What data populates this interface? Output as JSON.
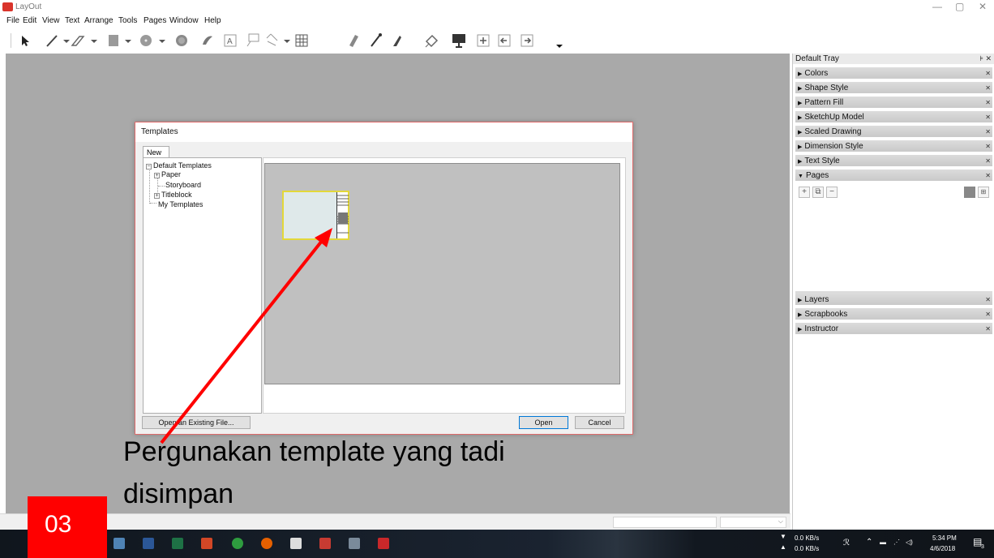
{
  "window": {
    "title": "LayOut",
    "controls": [
      "minimize",
      "maximize",
      "close"
    ]
  },
  "menu": [
    "File",
    "Edit",
    "View",
    "Text",
    "Arrange",
    "Tools",
    "Pages",
    "Window",
    "Help"
  ],
  "toolbar": {
    "icons": [
      "select-icon",
      "line-icon",
      "freehand-icon",
      "rectangle-icon",
      "circle-icon",
      "polygon-icon",
      "erase-icon",
      "text-icon",
      "label-icon",
      "dimension-icon",
      "table-icon",
      "split-icon",
      "eyedropper-icon",
      "paint-icon",
      "style-icon",
      "presentation-icon",
      "add-page-icon",
      "prev-page-icon",
      "next-page-icon"
    ]
  },
  "tray": {
    "title": "Default Tray",
    "panels_top": [
      "Colors",
      "Shape Style",
      "Pattern Fill",
      "SketchUp Model",
      "Scaled Drawing",
      "Dimension Style",
      "Text Style"
    ],
    "pages_panel": "Pages",
    "pages_tools": [
      "+",
      "⧉",
      "−"
    ],
    "panels_bottom": [
      "Layers",
      "Scrapbooks",
      "Instructor"
    ]
  },
  "dialog": {
    "title": "Templates",
    "tab": "New",
    "tree": {
      "root": "Default Templates",
      "children": [
        "Paper",
        "Storyboard",
        "Titleblock"
      ],
      "my_templates": "My Templates"
    },
    "buttons": {
      "open_existing": "Open an Existing File...",
      "open": "Open",
      "cancel": "Cancel"
    }
  },
  "annotation": {
    "badge": "03",
    "caption_line1": "Pergunakan template yang tadi",
    "caption_line2": "disimpan",
    "arrow_color": "#ff0000"
  },
  "taskbar": {
    "net_down": "0.0 KB/s",
    "net_up": "0.0 KB/s",
    "time": "5:34 PM",
    "date": "4/6/2018",
    "notification_count": "3"
  }
}
